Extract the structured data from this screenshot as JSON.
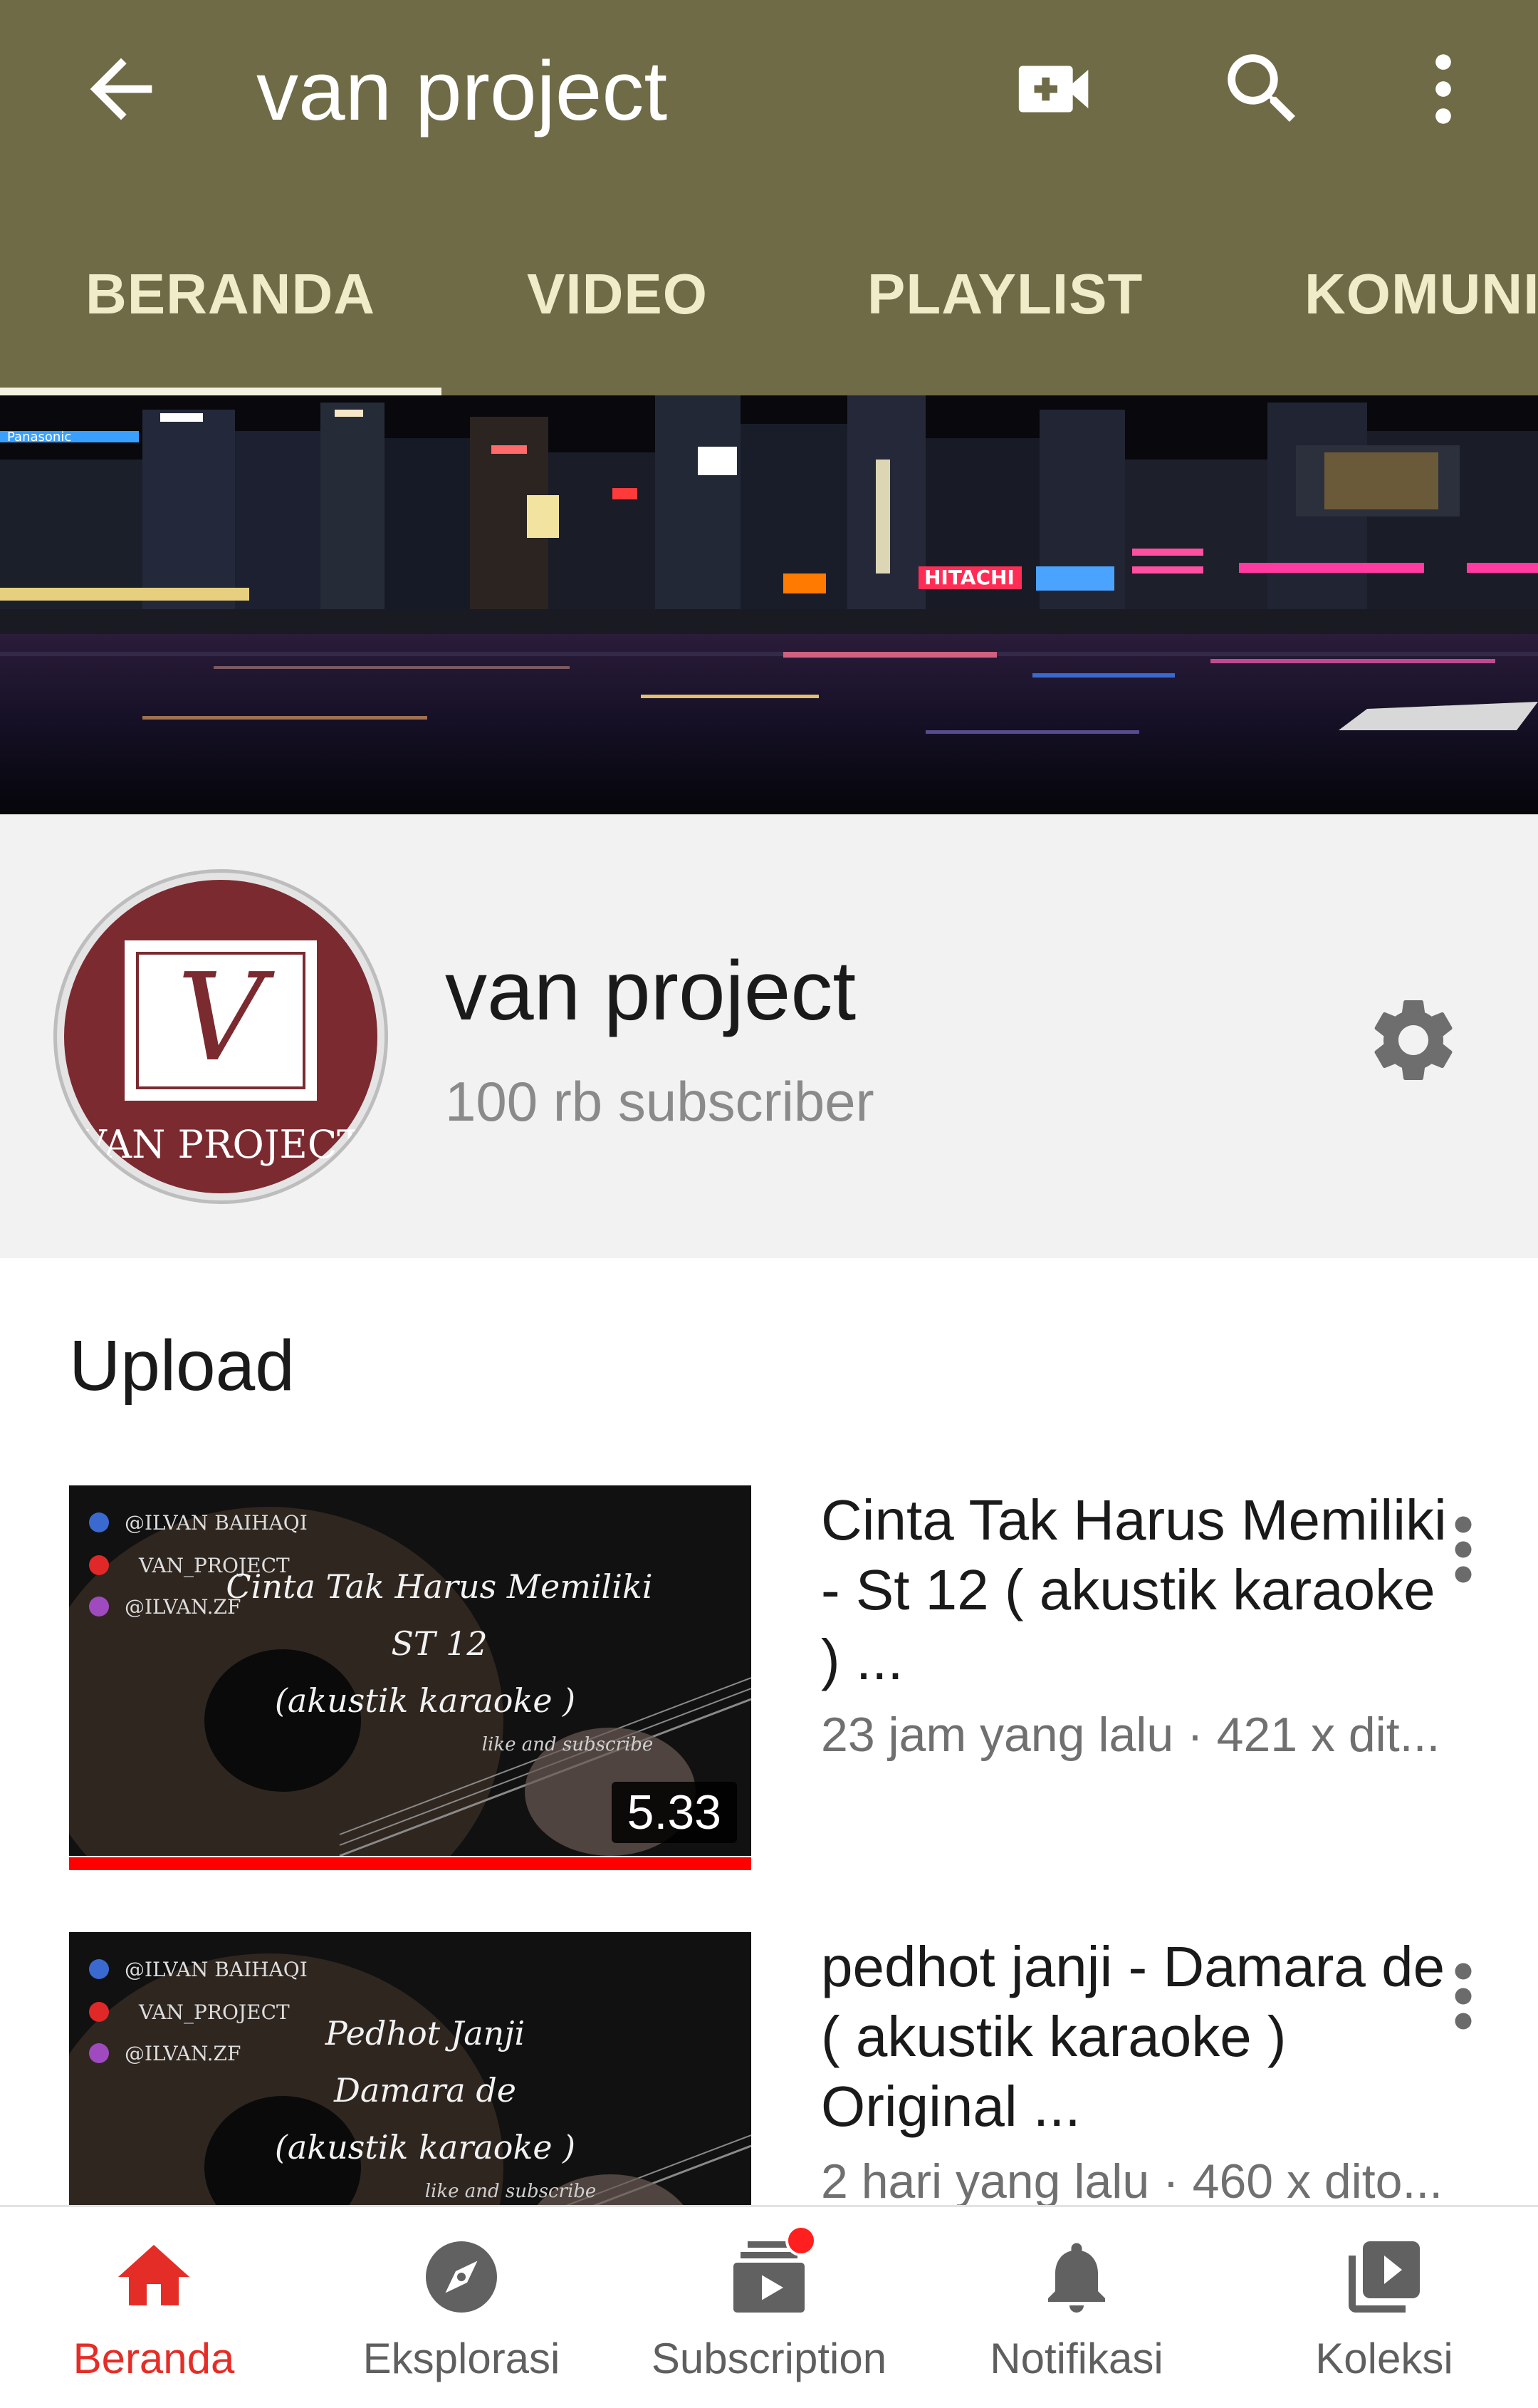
{
  "colors": {
    "appbar": "#6f6b46",
    "tab_text": "#f0ebc8",
    "accent_red": "#ff0000",
    "active_nav": "#e52d27",
    "avatar_maroon": "#7b2a30"
  },
  "appbar": {
    "back_icon": "arrow-left-icon",
    "title": "van project",
    "icons": [
      "video-add-icon",
      "search-icon",
      "more-vertical-icon"
    ]
  },
  "tabs": [
    {
      "label": "BERANDA",
      "active": true
    },
    {
      "label": "VIDEO",
      "active": false
    },
    {
      "label": "PLAYLIST",
      "active": false
    },
    {
      "label": "KOMUNITAS",
      "active": false
    }
  ],
  "banner": {
    "sign_texts": [
      "Panasonic",
      "HITACHI"
    ]
  },
  "channel": {
    "name": "van project",
    "subscribers": "100 rb subscriber",
    "avatar_letter": "V",
    "avatar_text": "VAN PROJECT",
    "settings_icon": "gear-icon"
  },
  "uploads": {
    "section_title": "Upload",
    "videos": [
      {
        "title": "Cinta Tak Harus Memiliki - St 12 ( akustik karaoke ) ...",
        "meta": "23 jam yang lalu · 421 x dit...",
        "duration": "5.33",
        "progress": 1.0,
        "thumb": {
          "socials": [
            "@ILVAN BAIHAQI",
            "VAN_PROJECT",
            "@ILVAN.ZF"
          ],
          "lines": [
            "Cinta Tak Harus Memiliki",
            "ST 12",
            "(akustik karaoke )"
          ],
          "tagline": "like and subscribe"
        }
      },
      {
        "title": "pedhot janji - Damara de ( akustik karaoke ) Original ...",
        "meta": "2 hari yang lalu · 460 x dito...",
        "duration": "",
        "progress": 0,
        "thumb": {
          "socials": [
            "@ILVAN BAIHAQI",
            "VAN_PROJECT",
            "@ILVAN.ZF"
          ],
          "lines": [
            "Pedhot Janji",
            "Damara de",
            "(akustik karaoke )"
          ],
          "tagline": "like and subscribe"
        }
      }
    ]
  },
  "bottom_nav": [
    {
      "label": "Beranda",
      "icon": "home-icon",
      "active": true
    },
    {
      "label": "Eksplorasi",
      "icon": "compass-icon",
      "active": false
    },
    {
      "label": "Subscription",
      "icon": "subscriptions-icon",
      "active": false,
      "badge": true
    },
    {
      "label": "Notifikasi",
      "icon": "bell-icon",
      "active": false
    },
    {
      "label": "Koleksi",
      "icon": "library-icon",
      "active": false
    }
  ]
}
